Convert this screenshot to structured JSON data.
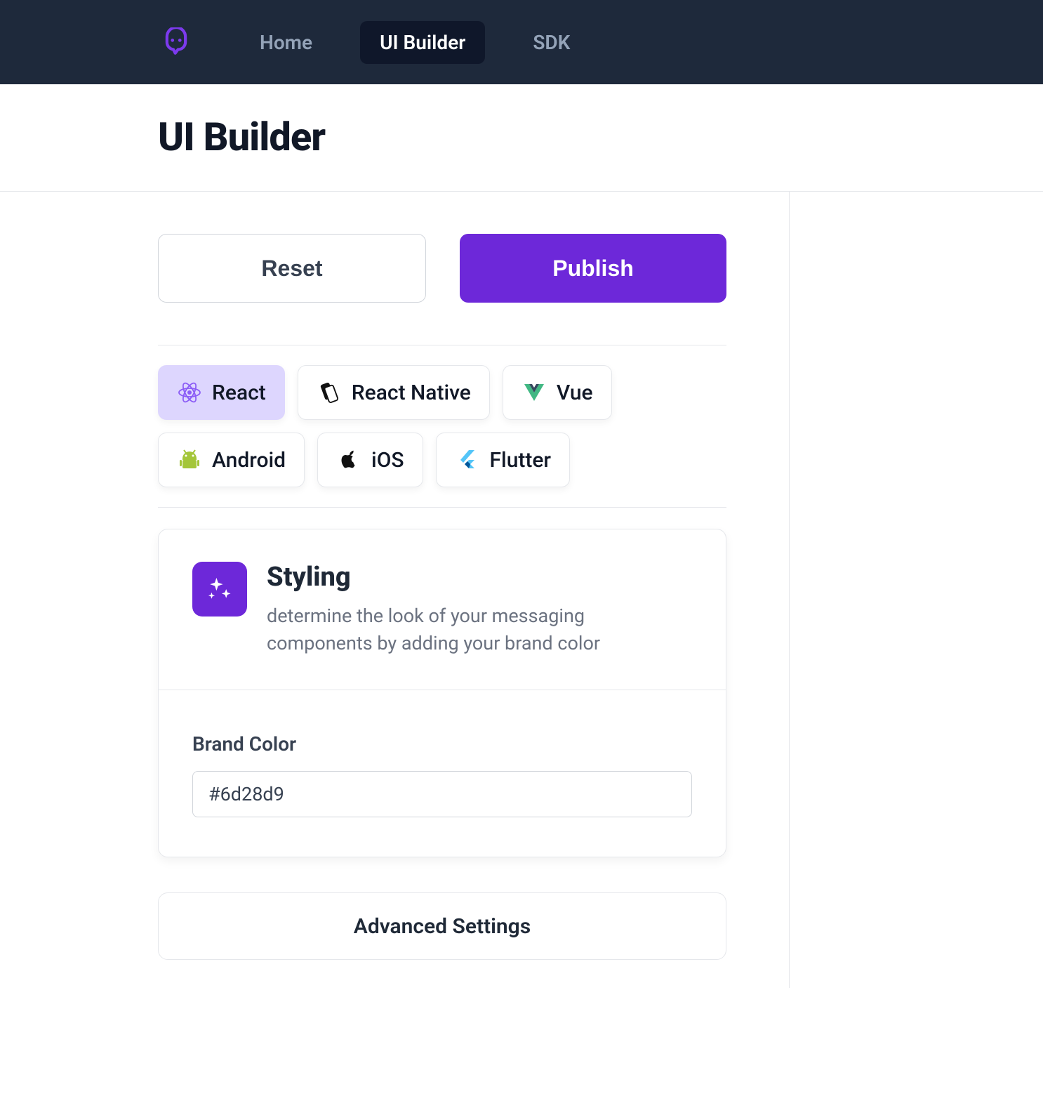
{
  "nav": {
    "items": [
      {
        "label": "Home",
        "active": false
      },
      {
        "label": "UI Builder",
        "active": true
      },
      {
        "label": "SDK",
        "active": false
      }
    ]
  },
  "page": {
    "title": "UI Builder"
  },
  "actions": {
    "reset_label": "Reset",
    "publish_label": "Publish"
  },
  "platforms": [
    {
      "label": "React",
      "selected": true,
      "icon": "react-icon"
    },
    {
      "label": "React Native",
      "selected": false,
      "icon": "react-native-icon"
    },
    {
      "label": "Vue",
      "selected": false,
      "icon": "vue-icon"
    },
    {
      "label": "Android",
      "selected": false,
      "icon": "android-icon"
    },
    {
      "label": "iOS",
      "selected": false,
      "icon": "apple-icon"
    },
    {
      "label": "Flutter",
      "selected": false,
      "icon": "flutter-icon"
    }
  ],
  "styling": {
    "title": "Styling",
    "description": "determine the look of your messaging components by adding your brand color",
    "brand_color_label": "Brand Color",
    "brand_color_value": "#6d28d9"
  },
  "advanced": {
    "label": "Advanced Settings"
  },
  "colors": {
    "primary": "#6d28d9"
  }
}
